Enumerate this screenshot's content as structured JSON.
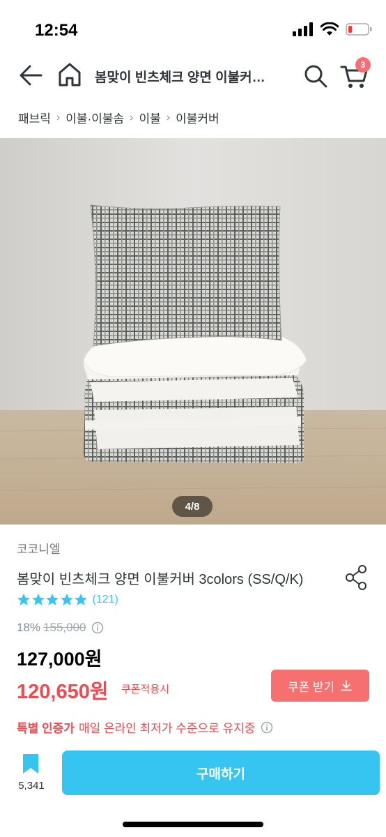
{
  "status": {
    "time": "12:54"
  },
  "nav": {
    "title": "봄맞이 빈츠체크 양면 이불커…",
    "cart_count": "3"
  },
  "breadcrumb": [
    "패브릭",
    "이불·이불솜",
    "이불",
    "이불커버"
  ],
  "image": {
    "counter": "4/8"
  },
  "product": {
    "brand": "코코니엘",
    "name": "봄맞이 빈츠체크 양면 이불커버 3colors (SS/Q/K)",
    "review_count": "(121)",
    "discount_rate": "18%",
    "original_price": "155,000",
    "sale_price": "127,000원",
    "coupon_price": "120,650원",
    "coupon_note": "쿠폰적용시",
    "coupon_button": "쿠폰 받기",
    "promo_bold": "특별 인증가",
    "promo_text": "매일 온라인 최저가 수준으로 유지중"
  },
  "bottom": {
    "bookmark_count": "5,341",
    "buy_label": "구매하기"
  },
  "colors": {
    "accent": "#35c5f0",
    "sale": "#f0494f",
    "coupon_button": "#f77070"
  }
}
